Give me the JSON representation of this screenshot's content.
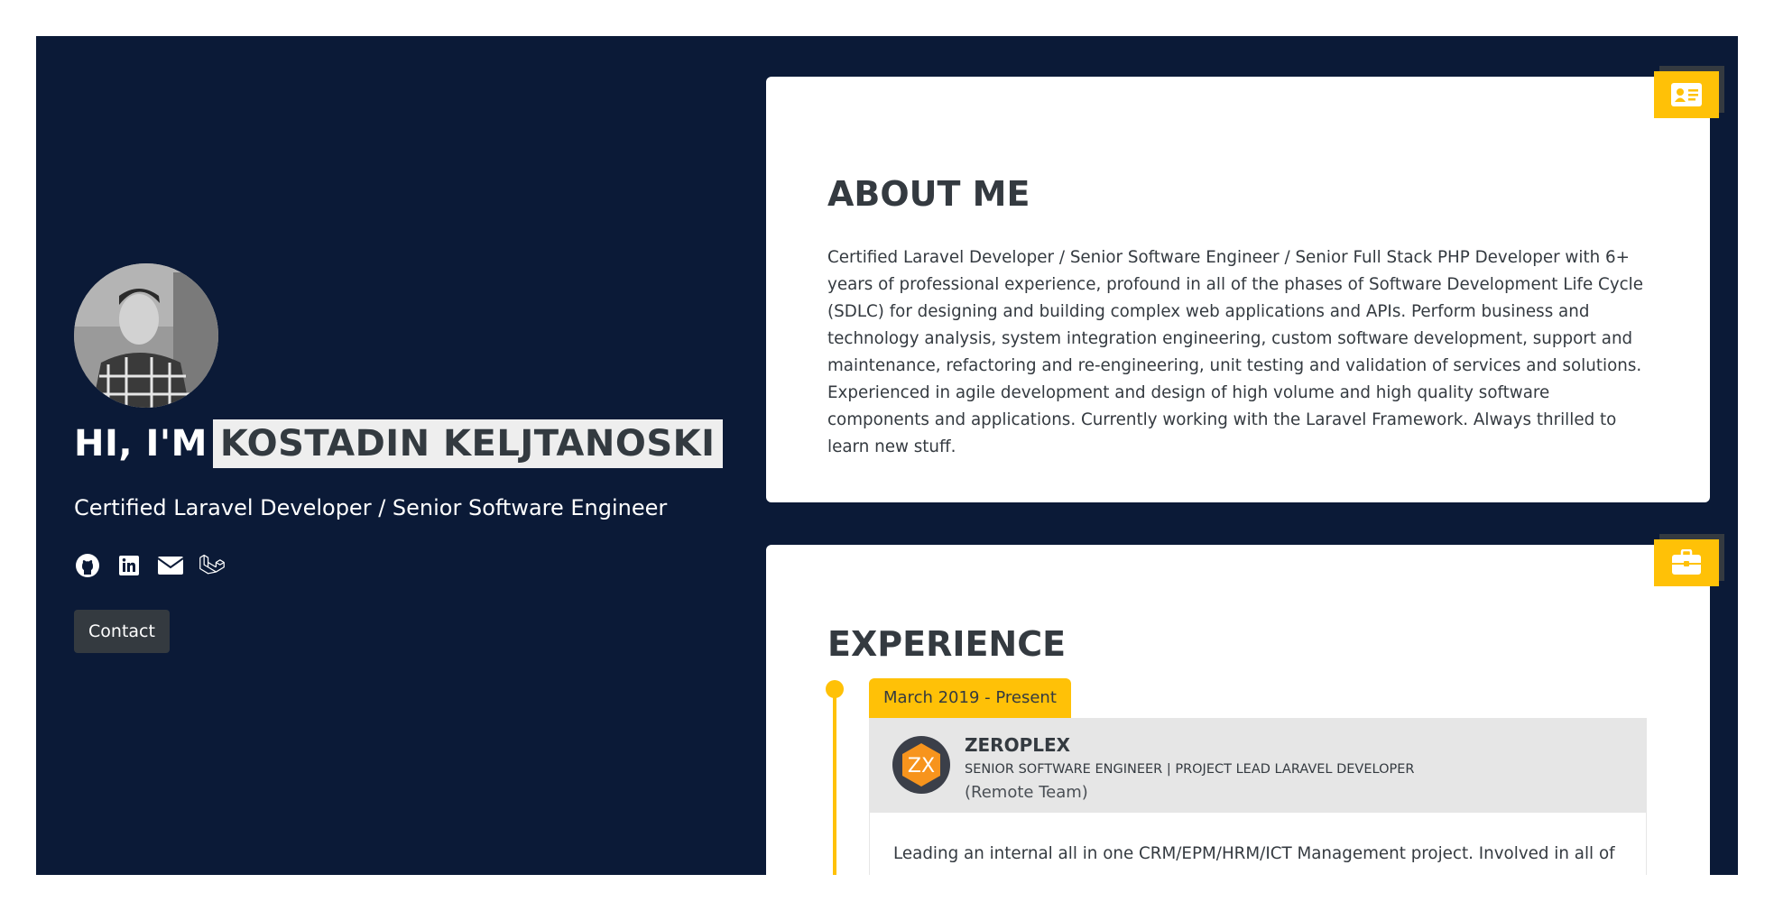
{
  "hero": {
    "greeting": "HI, I'M",
    "name": "KOSTADIN KELJTANOSKI",
    "subtitle": "Certified Laravel Developer / Senior Software Engineer",
    "contact_label": "Contact",
    "social_icons": [
      "github-icon",
      "linkedin-icon",
      "envelope-icon",
      "laravel-icon"
    ]
  },
  "about": {
    "title": "ABOUT ME",
    "badge_icon": "id-card-icon",
    "text": "Certified Laravel Developer / Senior Software Engineer / Senior Full Stack PHP Developer with 6+ years of professional experience, profound in all of the phases of Software Development Life Cycle (SDLC) for designing and building complex web applications and APIs. Perform business and technology analysis, system integration engineering, custom software development, support and maintenance, refactoring and re-engineering, unit testing and validation of services and solutions. Experienced in agile development and design of high volume and high quality software components and applications. Currently working with the Laravel Framework. Always thrilled to learn new stuff."
  },
  "experience": {
    "title": "EXPERIENCE",
    "badge_icon": "briefcase-icon",
    "jobs": [
      {
        "date": "March 2019 - Present",
        "logo_text": "ZX",
        "company": "ZEROPLEX",
        "role": "SENIOR SOFTWARE ENGINEER | PROJECT LEAD LARAVEL DEVELOPER",
        "team": "(Remote Team)",
        "description": "Leading an internal all in one CRM/EPM/HRM/ICT Management project. Involved in all of"
      }
    ]
  },
  "colors": {
    "background": "#0b1a37",
    "accent": "#ffc107",
    "card": "#ffffff",
    "dark": "#343a40",
    "name_highlight": "#eeeeee"
  }
}
